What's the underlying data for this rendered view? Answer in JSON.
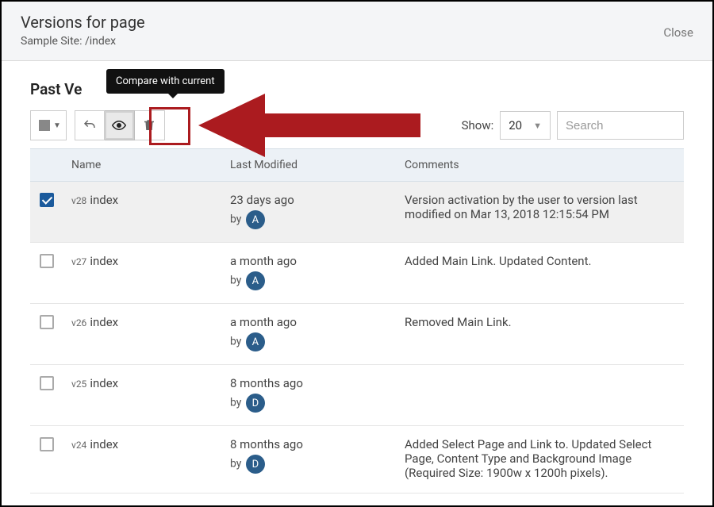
{
  "dialog": {
    "title": "Versions for page",
    "subtitle": "Sample Site: /index",
    "close_label": "Close"
  },
  "section_title": "Past Ve",
  "tooltip_text": "Compare with current",
  "toolbar": {
    "show_label": "Show:",
    "show_value": "20",
    "search_placeholder": "Search"
  },
  "table": {
    "headers": {
      "name": "Name",
      "modified": "Last Modified",
      "comments": "Comments"
    },
    "rows": [
      {
        "checked": true,
        "version": "v28",
        "name": "index",
        "modified_time": "23 days ago",
        "by_label": "by",
        "avatar_initial": "A",
        "comments": "Version activation by the user                 to version last modified on Mar 13, 2018 12:15:54 PM"
      },
      {
        "checked": false,
        "version": "v27",
        "name": "index",
        "modified_time": "a month ago",
        "by_label": "by",
        "avatar_initial": "A",
        "comments": "Added Main Link. Updated Content."
      },
      {
        "checked": false,
        "version": "v26",
        "name": "index",
        "modified_time": "a month ago",
        "by_label": "by",
        "avatar_initial": "A",
        "comments": "Removed Main Link."
      },
      {
        "checked": false,
        "version": "v25",
        "name": "index",
        "modified_time": "8 months ago",
        "by_label": "by",
        "avatar_initial": "D",
        "comments": ""
      },
      {
        "checked": false,
        "version": "v24",
        "name": "index",
        "modified_time": "8 months ago",
        "by_label": "by",
        "avatar_initial": "D",
        "comments": "Added Select Page and Link to. Updated Select Page, Content Type and Background Image (Required Size: 1900w x 1200h pixels)."
      }
    ]
  },
  "colors": {
    "highlight": "#ab1b1f",
    "avatar_bg": "#2b5d8a",
    "check_bg": "#1b5a9c"
  }
}
